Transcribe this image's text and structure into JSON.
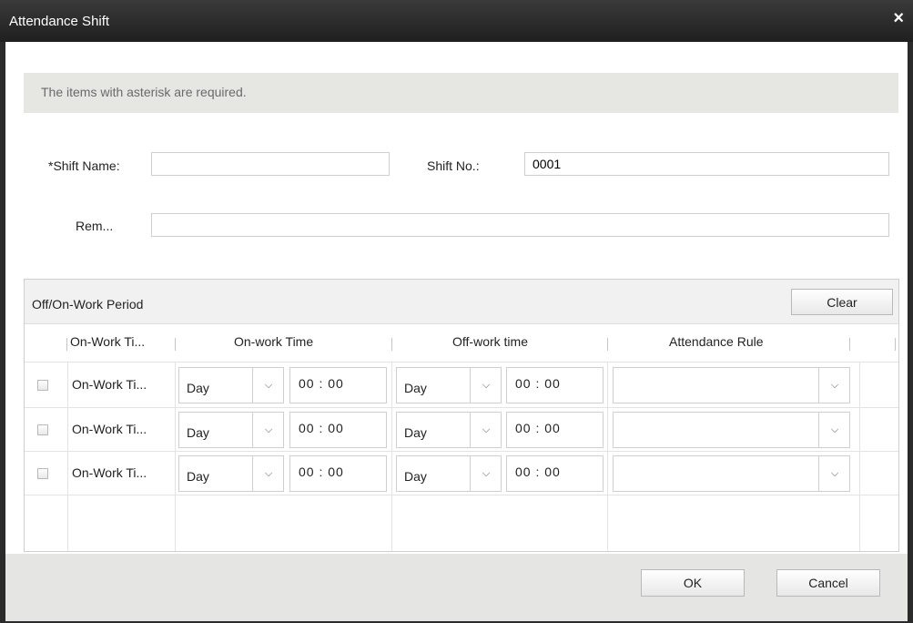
{
  "window": {
    "title": "Attendance Shift",
    "close_glyph": "×"
  },
  "banner": {
    "text": "The items with asterisk are required."
  },
  "form": {
    "shift_name_label": "*Shift Name:",
    "shift_name_value": "",
    "shift_no_label": "Shift No.:",
    "shift_no_value": "0001",
    "remark_label": "Rem...",
    "remark_value": ""
  },
  "period": {
    "title": "Off/On-Work Period",
    "clear_label": "Clear",
    "columns": [
      "On-Work Ti...",
      "On-work Time",
      "Off-work time",
      "Attendance Rule"
    ],
    "rows": [
      {
        "name": "On-Work Ti...",
        "on_day": "Day",
        "on_time": "00 : 00",
        "off_day": "Day",
        "off_time": "00 : 00",
        "rule": ""
      },
      {
        "name": "On-Work Ti...",
        "on_day": "Day",
        "on_time": "00 : 00",
        "off_day": "Day",
        "off_time": "00 : 00",
        "rule": ""
      },
      {
        "name": "On-Work Ti...",
        "on_day": "Day",
        "on_time": "00 : 00",
        "off_day": "Day",
        "off_time": "00 : 00",
        "rule": ""
      }
    ]
  },
  "footer": {
    "ok_label": "OK",
    "cancel_label": "Cancel"
  },
  "icons": {
    "dropdown": "chevron-down-icon",
    "close": "close-icon",
    "checkbox": "checkbox"
  }
}
